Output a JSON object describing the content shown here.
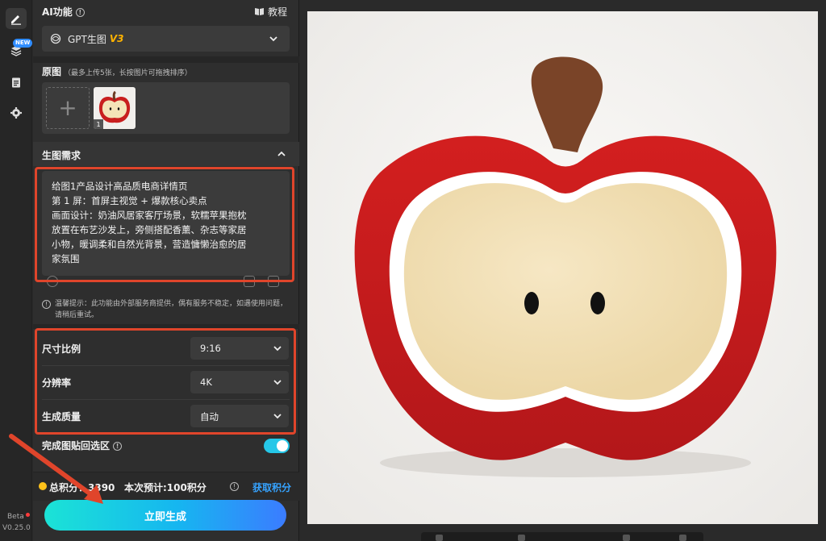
{
  "sidebar": {
    "items": [
      {
        "name": "edit",
        "icon": "pen-icon"
      },
      {
        "name": "layers",
        "icon": "layers-icon",
        "badge": "NEW"
      },
      {
        "name": "history",
        "icon": "clipboard-icon"
      },
      {
        "name": "settings",
        "icon": "gear-icon"
      }
    ],
    "beta_label": "Beta",
    "version": "V0.25.0"
  },
  "panel": {
    "ai_title": "AI功能",
    "tutorial_label": "教程",
    "model_name": "GPT生图",
    "model_version": "V3",
    "orig_label": "原图",
    "orig_hint": "（最多上传5张，长按图片可拖拽排序）",
    "thumb_index": "1",
    "req_title": "生图需求",
    "prompt_lines": [
      "给图1产品设计高品质电商详情页",
      "第 1 屏：首屏主视觉 + 爆款核心卖点",
      "画面设计：奶油风居家客厅场景，软糯苹果抱枕",
      "放置在布艺沙发上，旁侧搭配香薰、杂志等家居",
      "小物，暖调柔和自然光背景，营造慵懒治愈的居",
      "家氛围"
    ],
    "notice": "温馨提示：此功能由外部服务商提供，偶有服务不稳定，如遇使用问题，请稍后重试。",
    "options": [
      {
        "label": "尺寸比例",
        "value": "9:16"
      },
      {
        "label": "分辨率",
        "value": "4K"
      },
      {
        "label": "生成质量",
        "value": "自动"
      }
    ],
    "paste_label": "完成图贴回选区",
    "paste_enabled": true,
    "points_total": "总积分：3390",
    "points_est": "本次预计:100积分",
    "get_points": "获取积分",
    "generate_label": "立即生成"
  },
  "colors": {
    "accent": "#25c7e8",
    "highlight": "#e0452b",
    "link": "#36a3ff",
    "coin": "#ffc21a"
  }
}
